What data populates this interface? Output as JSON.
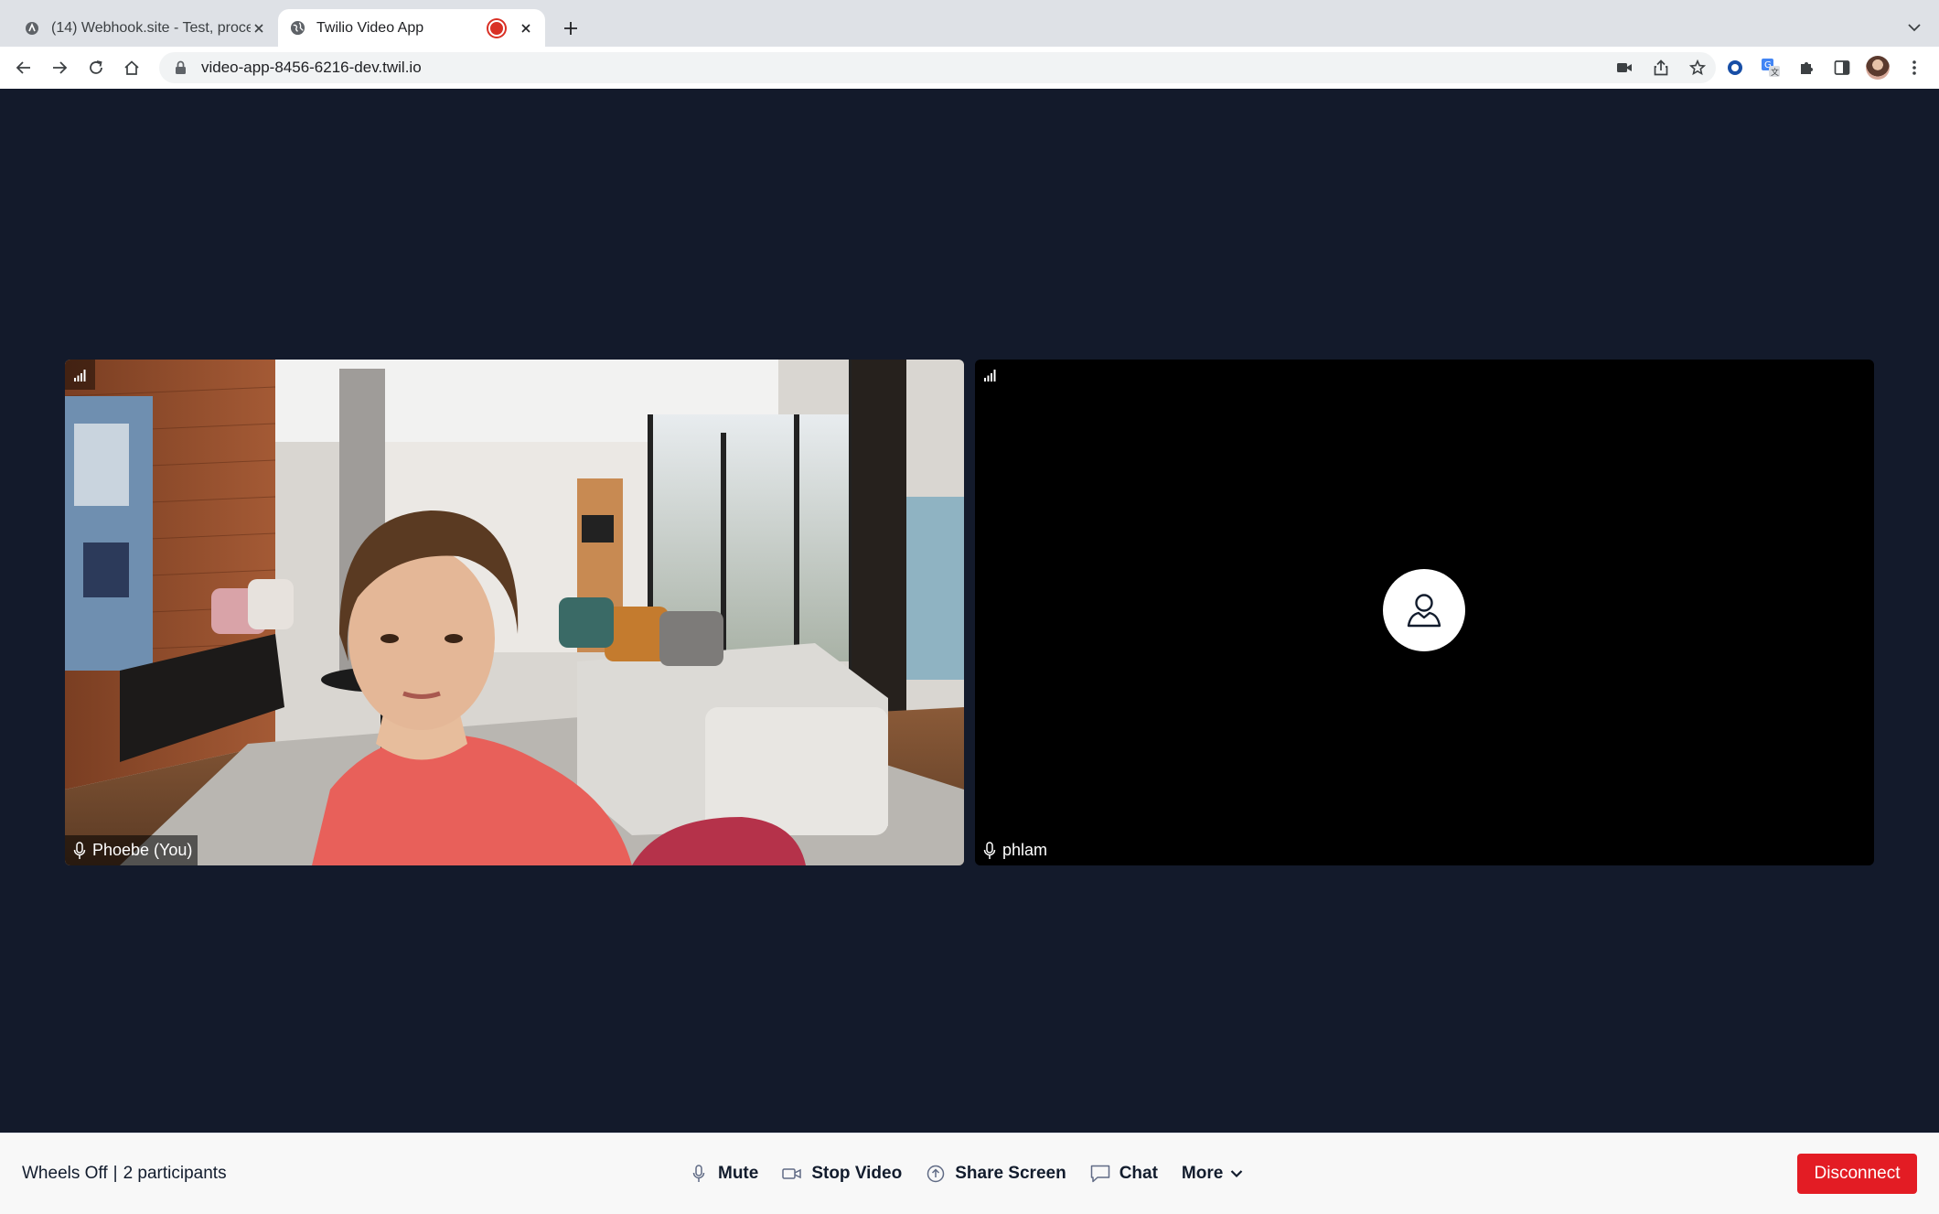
{
  "browser": {
    "tabs": [
      {
        "title": "(14) Webhook.site - Test, process and transform",
        "favicon": "webhook-favicon",
        "active": false
      },
      {
        "title": "Twilio Video App",
        "favicon": "globe-icon",
        "active": true,
        "recording": true
      }
    ],
    "url": "video-app-8456-6216-dev.twil.io",
    "icons": [
      "back-icon",
      "forward-icon",
      "reload-icon",
      "home-icon",
      "lock-icon",
      "camera-icon",
      "share-icon",
      "star-icon",
      "extension-circle-icon",
      "translate-icon",
      "puzzle-icon",
      "sidepanel-icon",
      "profile-avatar",
      "menu-icon"
    ]
  },
  "participants": [
    {
      "name": "Phoebe (You)",
      "video": true
    },
    {
      "name": "phlam",
      "video": false
    }
  ],
  "room": {
    "name": "Wheels Off",
    "separator": "|",
    "participant_count": "2 participants"
  },
  "controls": {
    "mute": "Mute",
    "stop_video": "Stop Video",
    "share_screen": "Share Screen",
    "chat": "Chat",
    "more": "More",
    "disconnect": "Disconnect"
  },
  "colors": {
    "background": "#131a2b",
    "disconnect": "#e31c24",
    "bottom_bar": "#f8f8f8"
  }
}
